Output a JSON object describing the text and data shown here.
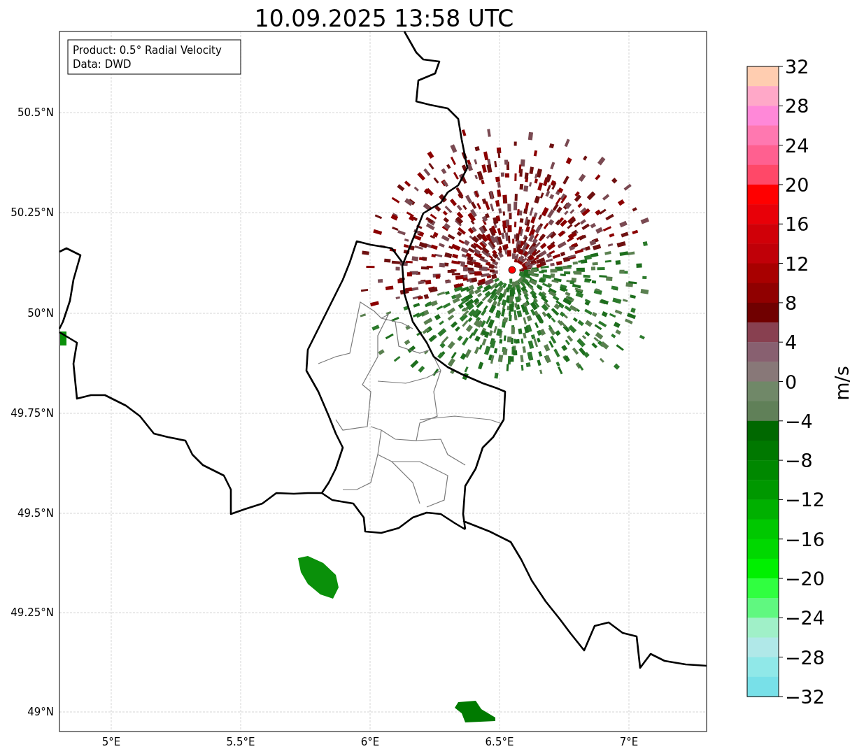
{
  "title": "10.09.2025 13:58 UTC",
  "legend": [
    "Product: 0.5° Radial Velocity",
    "Data: DWD"
  ],
  "lat_ticks": [
    "50.5°N",
    "50.25°N",
    "50°N",
    "49.75°N",
    "49.5°N",
    "49.25°N",
    "49°N"
  ],
  "lon_ticks": [
    "5°E",
    "5.5°E",
    "6°E",
    "6.5°E",
    "7°E"
  ],
  "colorbar": {
    "label": "m/s",
    "ticks": [
      "32",
      "28",
      "24",
      "20",
      "16",
      "12",
      "8",
      "4",
      "0",
      "−4",
      "−8",
      "−12",
      "−16",
      "−20",
      "−24",
      "−28",
      "−32"
    ],
    "segments": [
      {
        "color": "#ffcdb0"
      },
      {
        "color": "#ffa8c8"
      },
      {
        "color": "#ff88d8"
      },
      {
        "color": "#ff78b0"
      },
      {
        "color": "#ff6090"
      },
      {
        "color": "#ff4868"
      },
      {
        "color": "#ff0000"
      },
      {
        "color": "#e80008"
      },
      {
        "color": "#d00008"
      },
      {
        "color": "#c00008"
      },
      {
        "color": "#a80000"
      },
      {
        "color": "#900000"
      },
      {
        "color": "#700000"
      },
      {
        "color": "#884050"
      },
      {
        "color": "#886070"
      },
      {
        "color": "#887878"
      },
      {
        "color": "#708868"
      },
      {
        "color": "#608058"
      },
      {
        "color": "#006800"
      },
      {
        "color": "#007800"
      },
      {
        "color": "#008800"
      },
      {
        "color": "#009800"
      },
      {
        "color": "#00b000"
      },
      {
        "color": "#00c800"
      },
      {
        "color": "#00d800"
      },
      {
        "color": "#00f000"
      },
      {
        "color": "#30ff40"
      },
      {
        "color": "#60f880"
      },
      {
        "color": "#a0f0c8"
      },
      {
        "color": "#b0e8e8"
      },
      {
        "color": "#90e8e8"
      },
      {
        "color": "#78e0e8"
      }
    ]
  }
}
